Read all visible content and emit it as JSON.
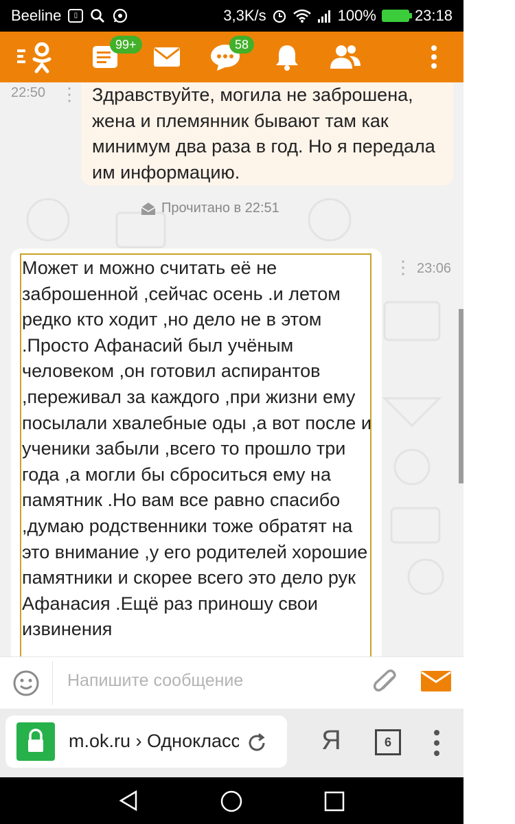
{
  "status_bar": {
    "carrier": "Beeline",
    "speed": "3,3K/s",
    "battery": "100%",
    "time": "23:18"
  },
  "header": {
    "notes_badge": "99+",
    "chats_badge": "58",
    "icons": [
      "ok-logo-icon",
      "feed-icon",
      "mail-icon",
      "chat-icon",
      "bell-icon",
      "friends-icon",
      "more-icon"
    ]
  },
  "chat": {
    "incoming": {
      "time": "22:50",
      "text": "Здравствуйте, могила не заброшена, жена и племянник бывают там как минимум два раза в год. Но я передала им информацию."
    },
    "read_status": "Прочитано в 22:51",
    "outgoing": {
      "time": "23:06",
      "text": "Может и можно считать её не заброшенной ,сейчас осень .и летом редко кто ходит ,но дело не в  этом .Просто Афанасий был учёным человеком ,он готовил аспирантов ,переживал за каждого ,при жизни ему посылали хвалебные оды ,а вот после и ученики забыли ,всего то прошло три года ,а могли бы сброситься ему на памятник .Но вам все равно спасибо ,думаю родственники тоже обратят на это внимание ,у его родителей хорошие памятники и скорее всего это дело рук Афанасия .Ещё раз приношу свои извинения"
    }
  },
  "composer": {
    "placeholder": "Напишите сообщение"
  },
  "browser": {
    "url": "m.ok.ru › Одноклассники",
    "yandex_label": "Я",
    "tab_count": "6"
  },
  "colors": {
    "brand_orange": "#ee8208",
    "badge_green": "#43b02a",
    "lock_green": "#26b14a"
  }
}
